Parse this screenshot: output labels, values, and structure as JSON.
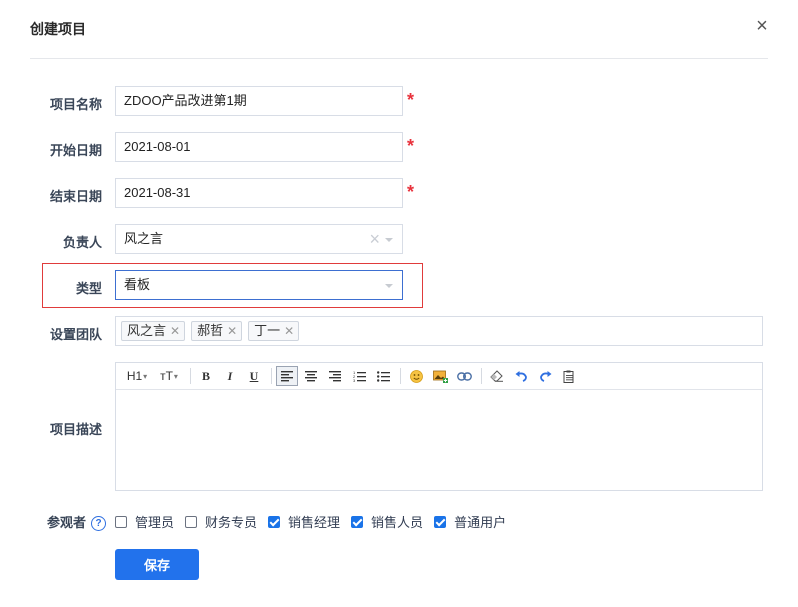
{
  "dialog": {
    "title": "创建项目",
    "close_glyph": "×"
  },
  "form": {
    "name": {
      "label": "项目名称",
      "value": "ZDOO产品改进第1期",
      "required": "*"
    },
    "start_date": {
      "label": "开始日期",
      "value": "2021-08-01",
      "required": "*"
    },
    "end_date": {
      "label": "结束日期",
      "value": "2021-08-31",
      "required": "*"
    },
    "owner": {
      "label": "负责人",
      "value": "风之言"
    },
    "type": {
      "label": "类型",
      "value": "看板"
    },
    "team": {
      "label": "设置团队",
      "members": [
        "风之言",
        "郝哲",
        "丁一"
      ]
    },
    "description": {
      "label": "项目描述",
      "toolbar": {
        "heading": "H1",
        "font_size": "тT",
        "bold": "B",
        "italic": "I",
        "underline": "U"
      },
      "value": ""
    },
    "viewers": {
      "label": "参观者",
      "help_glyph": "?",
      "options": [
        {
          "label": "管理员",
          "checked": false
        },
        {
          "label": "财务专员",
          "checked": false
        },
        {
          "label": "销售经理",
          "checked": true
        },
        {
          "label": "销售人员",
          "checked": true
        },
        {
          "label": "普通用户",
          "checked": true
        }
      ]
    },
    "save_label": "保存"
  },
  "colors": {
    "accent": "#2272ec",
    "required": "#e8323c",
    "highlight": "#e03b3b"
  }
}
